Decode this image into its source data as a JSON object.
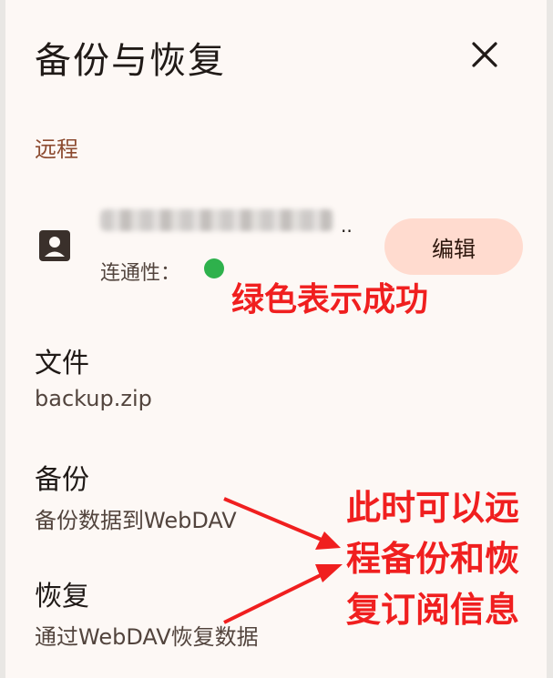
{
  "dialog": {
    "title": "备份与恢复",
    "close_icon": "close-icon"
  },
  "remote": {
    "section_label": "远程",
    "account_icon": "account-box-icon",
    "account_ellipsis": "..",
    "connectivity_label": "连通性：",
    "connectivity_status_color": "#2eb14c",
    "edit_label": "编辑"
  },
  "file": {
    "title": "文件",
    "value": "backup.zip"
  },
  "backup": {
    "title": "备份",
    "subtitle": "备份数据到WebDAV"
  },
  "restore": {
    "title": "恢复",
    "subtitle": "通过WebDAV恢复数据"
  },
  "annotations": {
    "green_success": "绿色表示成功",
    "remote_info": "此时可以远程备份和恢复订阅信息",
    "color": "#f01f1f"
  }
}
